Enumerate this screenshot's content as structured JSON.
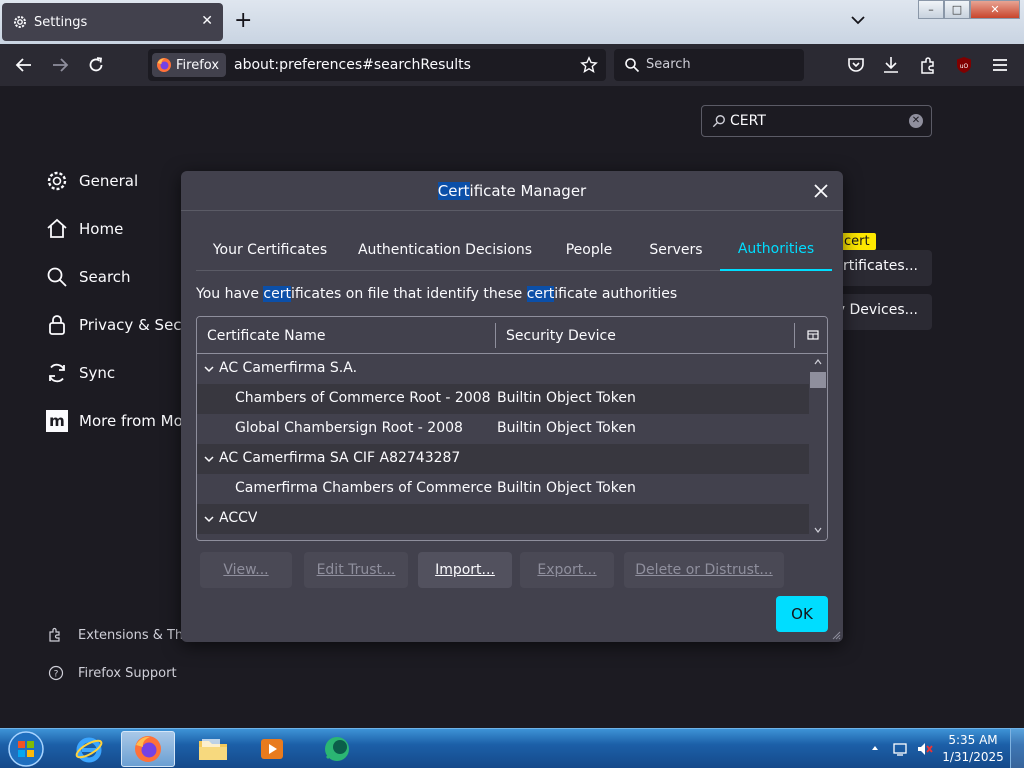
{
  "tab": {
    "title": "Settings",
    "close_label": "✕"
  },
  "newtab_label": "+",
  "window_controls": {
    "minimize": "–",
    "maximize": "□",
    "close": "✕"
  },
  "urlbar": {
    "identity_label": "Firefox",
    "url": "about:preferences#searchResults"
  },
  "searchbar": {
    "placeholder": "Search"
  },
  "settings": {
    "find_value": "CERT",
    "sidebar": [
      {
        "label": "General",
        "icon": "gear-icon"
      },
      {
        "label": "Home",
        "icon": "home-icon"
      },
      {
        "label": "Search",
        "icon": "search-icon"
      },
      {
        "label": "Privacy & Secu",
        "icon": "lock-icon"
      },
      {
        "label": "Sync",
        "icon": "sync-icon"
      },
      {
        "label": "More from Mo",
        "icon": "mozilla-icon"
      }
    ],
    "footer": [
      {
        "label": "Extensions & The",
        "icon": "puzzle-icon"
      },
      {
        "label": "Firefox Support",
        "icon": "help-icon"
      }
    ],
    "bg_highlight": "cert",
    "bg_buttons": [
      "rtificates...",
      "y Devices..."
    ]
  },
  "dialog": {
    "title_hl": "Cert",
    "title_rest": "ificate Manager",
    "tabs": [
      "Your Certificates",
      "Authentication Decisions",
      "People",
      "Servers",
      "Authorities"
    ],
    "active_tab": 4,
    "desc": {
      "p1": "You have ",
      "hl1": "cert",
      "p2": "ificates on file that identify these ",
      "hl2": "cert",
      "p3": "ificate authorities"
    },
    "columns": [
      "Certificate Name",
      "Security Device"
    ],
    "rows": [
      {
        "name": "AC Camerfirma S.A.",
        "device": "",
        "group": true
      },
      {
        "name": "Chambers of Commerce Root - 2008",
        "device": "Builtin Object Token",
        "group": false
      },
      {
        "name": "Global Chambersign Root - 2008",
        "device": "Builtin Object Token",
        "group": false
      },
      {
        "name": "AC Camerfirma SA CIF A82743287",
        "device": "",
        "group": true
      },
      {
        "name": "Camerfirma Chambers of Commerce ...",
        "device": "Builtin Object Token",
        "group": false
      },
      {
        "name": "ACCV",
        "device": "",
        "group": true
      }
    ],
    "buttons": {
      "view": "View...",
      "edit_trust": "Edit Trust...",
      "import": "Import...",
      "export": "Export...",
      "delete": "Delete or Distrust..."
    },
    "ok": "OK"
  },
  "taskbar": {
    "apps": [
      "internet-explorer",
      "firefox",
      "file-explorer",
      "media-player",
      "app"
    ],
    "clock_time": "5:35 AM",
    "clock_date": "1/31/2025"
  },
  "colors": {
    "accent": "#00ddff",
    "highlight": "#0b4fa8",
    "find_highlight": "#ffe900"
  }
}
